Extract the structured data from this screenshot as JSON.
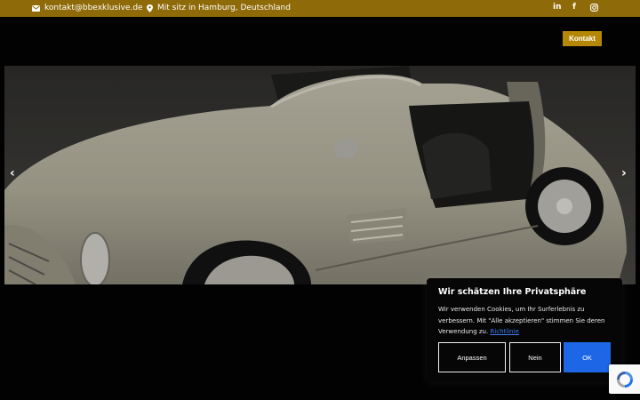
{
  "topbar": {
    "email": "kontakt@bbexklusive.de",
    "location": "Mit sitz in Hamburg, Deutschland",
    "social": [
      "in",
      "f",
      "instagram-icon"
    ],
    "background": "#8f6a08"
  },
  "header": {
    "contact_button": "Kontakt",
    "accent": "#b58707"
  },
  "hero": {
    "image": "silver gullwing sports car with open door",
    "prev_arrow": "‹",
    "next_arrow": "›"
  },
  "cookie": {
    "title": "Wir schätzen Ihre Privatsphäre",
    "text": "Wir verwenden Cookies, um Ihr Surferlebnis zu verbessern. Mit \"Alle akzeptieren\" stimmen Sie deren Verwendung zu.",
    "link": "Richtlinie",
    "buttons": {
      "customize": "Anpassen",
      "reject": "Nein",
      "accept": "OK"
    },
    "accept_color": "#1d67e6"
  }
}
